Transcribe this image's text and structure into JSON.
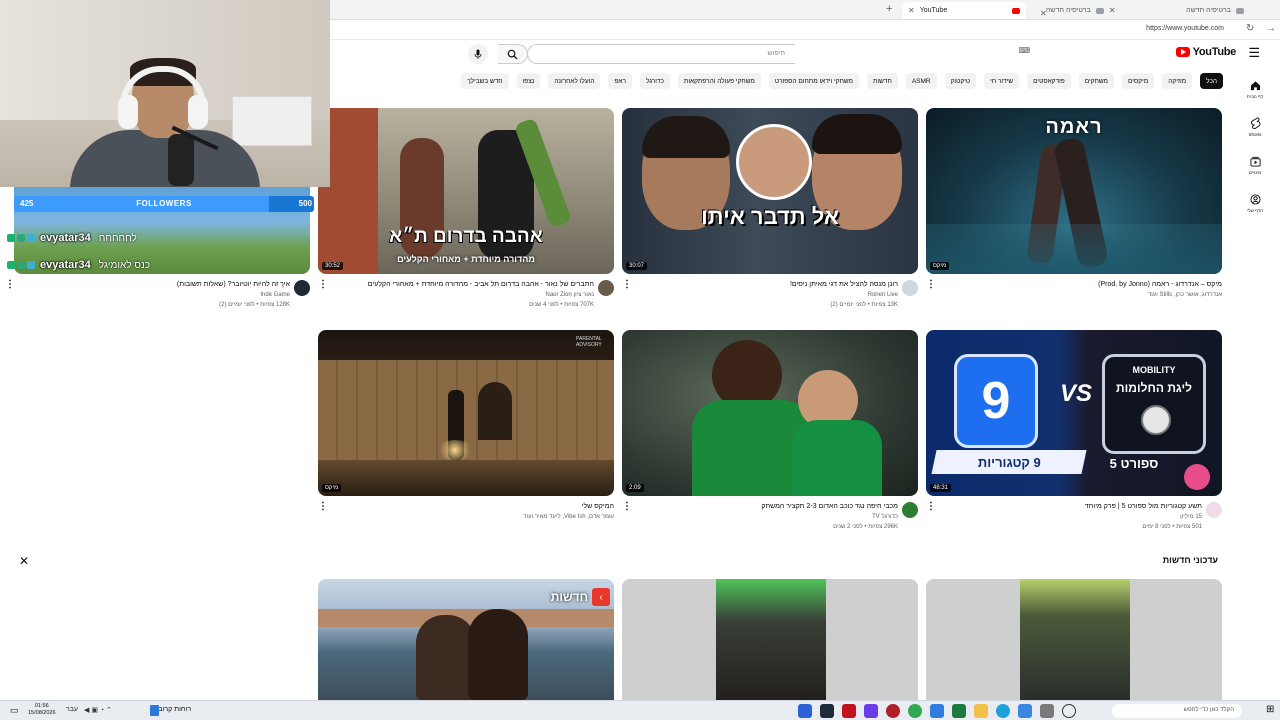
{
  "browser": {
    "tabs": [
      {
        "label": "YouTube",
        "active": true
      },
      {
        "label": "ברטיסיה חדשה",
        "active": false
      },
      {
        "label": "ברטיסיה חדשה",
        "active": false
      }
    ],
    "url": "https://www.youtube.com"
  },
  "youtube": {
    "logo_text": "YouTube",
    "search_placeholder": "חיפוש",
    "chips": [
      "הכל",
      "מוזיקה",
      "מיקסים",
      "משחקים",
      "פודקאסטים",
      "שידור חי",
      "טיקטוק",
      "ASMR",
      "חדשות",
      "משחקי וידאו מתחום הספורט",
      "משחקי פעולה והרפתקאות",
      "כדורגל",
      "ראפ",
      "הועלו לאחרונה",
      "נצפו",
      "חדש בשבילך"
    ],
    "guide": [
      {
        "label": "דף הבית",
        "icon": "home-icon"
      },
      {
        "label": "Shorts",
        "icon": "shorts-icon"
      },
      {
        "label": "מינויים",
        "icon": "subscriptions-icon"
      },
      {
        "label": "הדף שלי",
        "icon": "you-icon"
      }
    ],
    "videos_row1": [
      {
        "title": "מיקס – אנדרדוג - ראמה (Prod. by Jonno)",
        "channel": "אנדרדוג, אושר כהן, Stills ועוד",
        "stats": "",
        "duration": "מיקס",
        "overlay": "ראמה"
      },
      {
        "title": "רונן מנסה להציל את דגי מאיתן ניסים!",
        "channel": "Ronen Live",
        "stats": "13K צפיות • לפני יומיים (2)",
        "duration": "30:07",
        "overlay": "אל תדבר איתו"
      },
      {
        "title": "התברים של נאור - אהבה בדרום תל אביב - מהדורה מיוחדת + מאחורי הקלעים",
        "channel": "נאור ציון Naor Zion",
        "stats": "707K צפיות • לפני 4 שנים",
        "duration": "30:52",
        "overlay": "אהבה בדרום ת״א",
        "overlay_sub": "מהדורה מיוחדת + מאחורי הקלעים"
      },
      {
        "title": "איך זה להיות יוטיובר? (שאלות תשובות)",
        "channel": "Inde Game",
        "stats": "128K צפיות • לפני יומיים (2)",
        "duration": ""
      }
    ],
    "videos_row2": [
      {
        "title": "תשע קטגוריות מול ספורט 5 | פרק מיוחד",
        "channel": "15 מיליון",
        "stats": "501 צפיות • לפני 8 ימים",
        "duration": "48:31",
        "overlay": "9 קטגוריות",
        "overlay_sub": "ליגת החלומות",
        "overlay_small": "ספורט 5",
        "overlay_brand": "MOBILITY"
      },
      {
        "title": "מכבי חיפה נגד כוכב האדום 2-3 תקציר המשחק",
        "channel": "כדורגל TV",
        "stats": "296K צפיות • לפני 2 שנים",
        "duration": "2:09"
      },
      {
        "title": "המיקס שלי",
        "channel": "עומר אדם, Vibe Ish, ליעד מאיר ועוד",
        "stats": "",
        "duration": "מיקס"
      }
    ],
    "section_title": "עדכוני חדשות",
    "news_overlay": "חדשות"
  },
  "stream_overlay": {
    "goal_current": "425",
    "goal_label": "FOLLOWERS",
    "goal_target": "500",
    "goal_fraction": 0.85,
    "chat": [
      {
        "user": "evyatar34",
        "msg": "לחחחחח"
      },
      {
        "user": "evyatar34",
        "msg": "כנס לאומיגל"
      }
    ]
  },
  "taskbar": {
    "search_placeholder": "הקלד כאן כדי לחפש",
    "weather": "רוחות קרובים",
    "time": "01:56",
    "date": "15/08/2026",
    "lang": "עבר"
  },
  "colors": {
    "accent": "#ff0000",
    "chip_active": "#0f0f0f",
    "goal": "#1877d2"
  }
}
